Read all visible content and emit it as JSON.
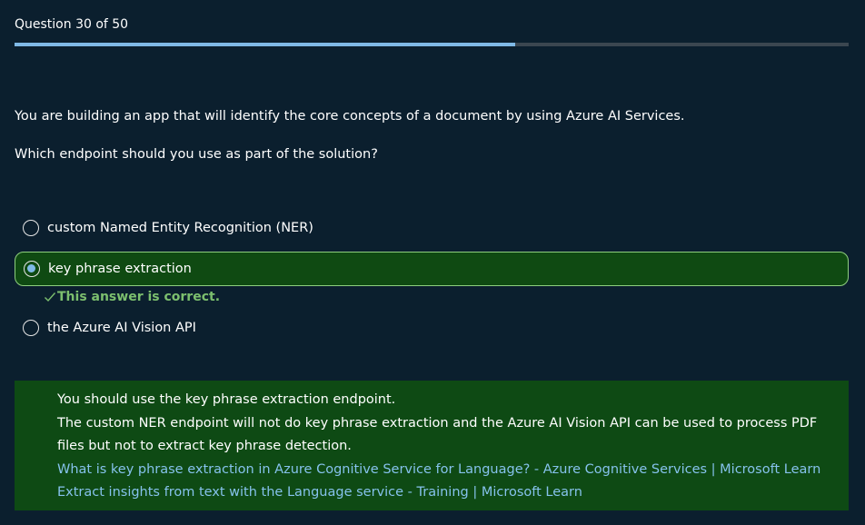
{
  "progress": {
    "label": "Question 30 of 50",
    "current": 30,
    "total": 50,
    "fraction": 0.6
  },
  "question": {
    "text": "You are building an app that will identify the core concepts of a document by using Azure AI Services.",
    "prompt": "Which endpoint should you use as part of the solution?"
  },
  "options": [
    {
      "label": "custom Named Entity Recognition (NER)",
      "selected": false
    },
    {
      "label": "key phrase extraction",
      "selected": true
    },
    {
      "label": "the Azure AI Vision API",
      "selected": false
    }
  ],
  "feedback": {
    "text": "This answer is correct.",
    "color": "#7cbf6e"
  },
  "explanation": {
    "line1": "You should use the key phrase extraction endpoint.",
    "line2": "The custom NER endpoint will not do key phrase extraction and the Azure AI Vision API can be used to process PDF",
    "line3": "files but not to extract key phrase detection.",
    "links": [
      "What is key phrase extraction in Azure Cognitive Service for Language? - Azure Cognitive Services | Microsoft Learn",
      "Extract insights from text with the Language service - Training | Microsoft Learn"
    ]
  },
  "colors": {
    "background": "#0b1f2e",
    "accent": "#7fb9e6",
    "correct_bg": "#0f4a12",
    "link": "#86c2ec"
  }
}
